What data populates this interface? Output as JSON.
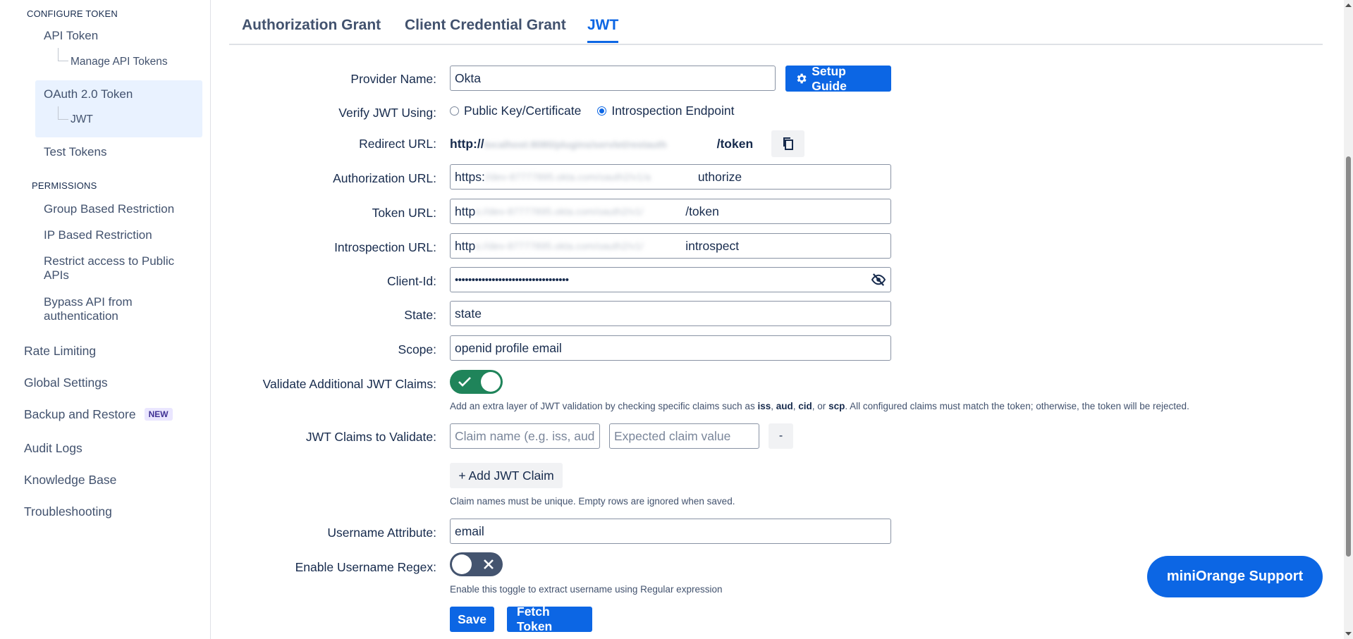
{
  "sidebar": {
    "configure_token": "CONFIGURE TOKEN",
    "api_token": "API Token",
    "manage_api_tokens": "Manage API Tokens",
    "oauth_token": "OAuth 2.0 Token",
    "jwt": "JWT",
    "test_tokens": "Test Tokens",
    "permissions": "PERMISSIONS",
    "group_restriction": "Group Based Restriction",
    "ip_restriction": "IP Based Restriction",
    "restrict_public": "Restrict access to Public APIs",
    "bypass_api": "Bypass API from authentication",
    "rate_limiting": "Rate Limiting",
    "global_settings": "Global Settings",
    "backup_restore": "Backup and Restore",
    "new_badge": "NEW",
    "audit_logs": "Audit Logs",
    "knowledge_base": "Knowledge Base",
    "troubleshooting": "Troubleshooting"
  },
  "tabs": {
    "authorization_grant": "Authorization Grant",
    "client_credential_grant": "Client Credential Grant",
    "jwt": "JWT"
  },
  "form": {
    "provider_name_label": "Provider Name:",
    "provider_name_value": "Okta",
    "setup_guide": "Setup Guide",
    "verify_jwt_label": "Verify JWT Using:",
    "option_public_key": "Public Key/Certificate",
    "option_introspection": "Introspection Endpoint",
    "redirect_url_label": "Redirect URL:",
    "redirect_url_prefix": "http://",
    "redirect_url_hidden": "localhost:8080/plugins/servlet/restauth",
    "redirect_url_suffix": "/token",
    "authorization_url_label": "Authorization URL:",
    "authorization_url_prefix": "https:",
    "authorization_url_hidden": "//dev-87777895.okta.com/oauth2/v1/a",
    "authorization_url_suffix": "uthorize",
    "token_url_label": "Token URL:",
    "token_url_prefix": "http",
    "token_url_hidden": "s://dev-87777895.okta.com/oauth2/v1/",
    "token_url_suffix": "/token",
    "introspection_url_label": "Introspection URL:",
    "introspection_url_prefix": "http",
    "introspection_url_hidden": "s://dev-87777895.okta.com/oauth2/v1/",
    "introspection_url_suffix": "introspect",
    "client_id_label": "Client-Id:",
    "client_id_masked": "••••••••••••••••••••••••••••••••••",
    "state_label": "State:",
    "state_value": "state",
    "scope_label": "Scope:",
    "scope_value": "openid profile email",
    "validate_claims_label": "Validate Additional JWT Claims:",
    "validate_claims_help_1": "Add an extra layer of JWT validation by checking specific claims such as ",
    "claim_iss": "iss",
    "comma_1": ", ",
    "claim_aud": "aud",
    "comma_2": ", ",
    "claim_cid": "cid",
    "or_text": ", or ",
    "claim_scp": "scp",
    "validate_claims_help_2": ". All configured claims must match the token; otherwise, the token will be rejected.",
    "claims_to_validate_label": "JWT Claims to Validate:",
    "claim_name_placeholder": "Claim name (e.g. iss, aud)",
    "claim_value_placeholder": "Expected claim value",
    "remove_claim": "-",
    "add_claim": "+ Add JWT Claim",
    "claims_help": "Claim names must be unique. Empty rows are ignored when saved.",
    "username_attr_label": "Username Attribute:",
    "username_attr_value": "email",
    "enable_regex_label": "Enable Username Regex:",
    "regex_help": "Enable this toggle to extract username using Regular expression",
    "save": "Save",
    "fetch_token": "Fetch Token"
  },
  "support_button": "miniOrange Support",
  "toggles": {
    "validate_claims_on": true,
    "username_regex_on": false
  },
  "colors": {
    "primary": "#0c66e4",
    "toggle_on": "#1f845a",
    "toggle_off": "#44546f",
    "active_nav_bg": "#e9f2ff"
  }
}
